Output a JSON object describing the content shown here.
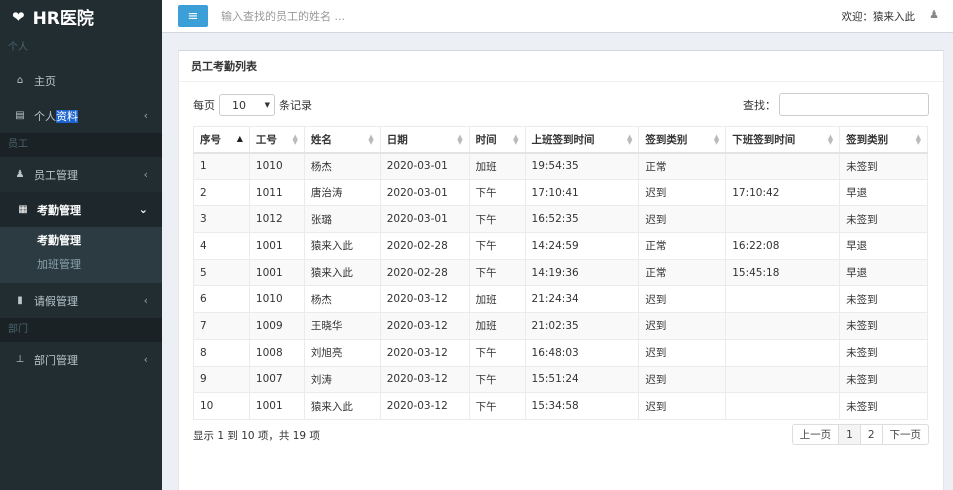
{
  "app": {
    "logo_icon": "heartbeat-icon",
    "title": "HR医院"
  },
  "header": {
    "toggle_icon": "hamburger-icon",
    "search_placeholder": "输入查找的员工的姓名 ...",
    "welcome": "欢迎：猿来入此",
    "user_icon": "user-icon"
  },
  "sidebar": {
    "section_personal": "个人",
    "home": "主页",
    "profile_pre": "个人",
    "profile_hl": "资料",
    "section_staff": "员工",
    "staff_mgmt": "员工管理",
    "attendance_mgmt": "考勤管理",
    "sub_attendance": "考勤管理",
    "sub_overtime": "加班管理",
    "leave_mgmt": "请假管理",
    "section_dept": "部门",
    "dept_mgmt": "部门管理"
  },
  "box": {
    "title": "员工考勤列表",
    "length_pre": "每页",
    "length_value": "10",
    "length_post": "条记录",
    "search_label": "查找："
  },
  "table": {
    "columns": [
      "序号",
      "工号",
      "姓名",
      "日期",
      "时间",
      "上班签到时间",
      "签到类别",
      "下班签到时间",
      "签到类别"
    ],
    "rows": [
      [
        "1",
        "1010",
        "杨杰",
        "2020-03-01",
        "加班",
        "19:54:35",
        "正常",
        "",
        "未签到"
      ],
      [
        "2",
        "1011",
        "唐治涛",
        "2020-03-01",
        "下午",
        "17:10:41",
        "迟到",
        "17:10:42",
        "早退"
      ],
      [
        "3",
        "1012",
        "张璐",
        "2020-03-01",
        "下午",
        "16:52:35",
        "迟到",
        "",
        "未签到"
      ],
      [
        "4",
        "1001",
        "猿来入此",
        "2020-02-28",
        "下午",
        "14:24:59",
        "正常",
        "16:22:08",
        "早退"
      ],
      [
        "5",
        "1001",
        "猿来入此",
        "2020-02-28",
        "下午",
        "14:19:36",
        "正常",
        "15:45:18",
        "早退"
      ],
      [
        "6",
        "1010",
        "杨杰",
        "2020-03-12",
        "加班",
        "21:24:34",
        "迟到",
        "",
        "未签到"
      ],
      [
        "7",
        "1009",
        "王晓华",
        "2020-03-12",
        "加班",
        "21:02:35",
        "迟到",
        "",
        "未签到"
      ],
      [
        "8",
        "1008",
        "刘旭亮",
        "2020-03-12",
        "下午",
        "16:48:03",
        "迟到",
        "",
        "未签到"
      ],
      [
        "9",
        "1007",
        "刘涛",
        "2020-03-12",
        "下午",
        "15:51:24",
        "迟到",
        "",
        "未签到"
      ],
      [
        "10",
        "1001",
        "猿来入此",
        "2020-03-12",
        "下午",
        "15:34:58",
        "迟到",
        "",
        "未签到"
      ]
    ]
  },
  "footer": {
    "info": "显示 1 到 10 项，共 19 项",
    "prev": "上一页",
    "page1": "1",
    "page2": "2",
    "next": "下一页"
  }
}
